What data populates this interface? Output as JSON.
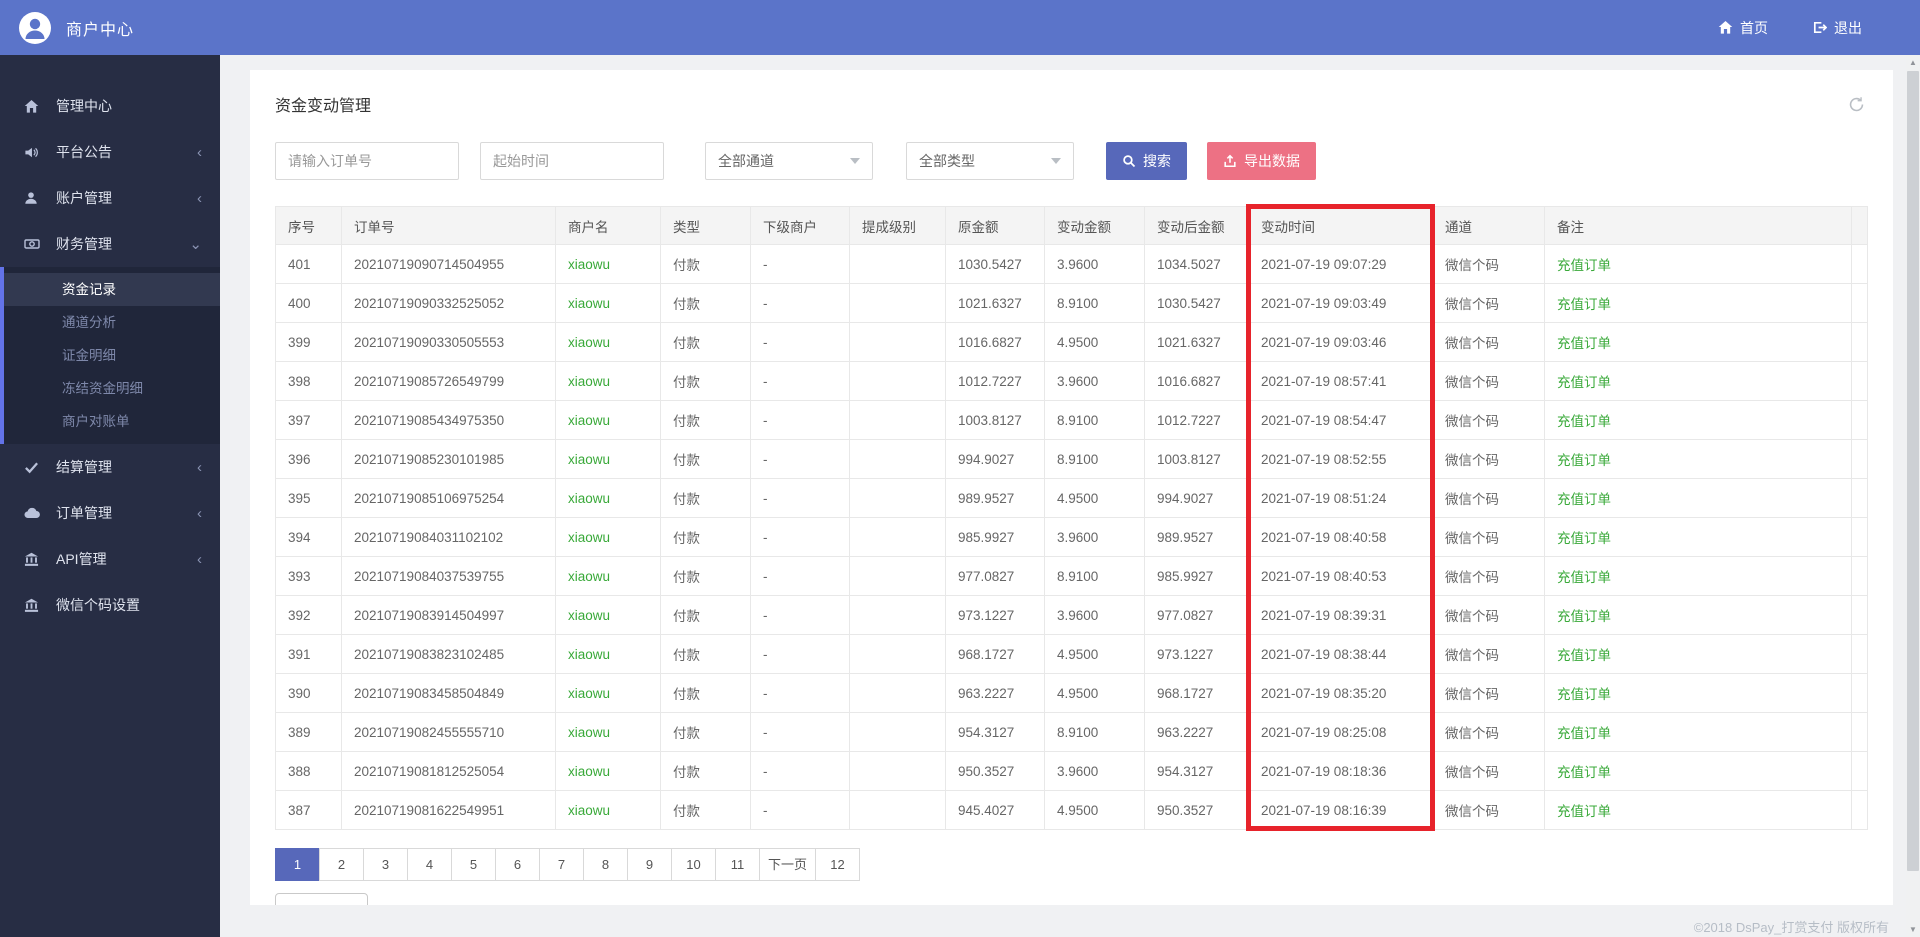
{
  "navbar": {
    "brand": "商户中心",
    "home_label": "首页",
    "logout_label": "退出"
  },
  "sidebar": {
    "items": [
      {
        "label": "管理中心",
        "chevron": ""
      },
      {
        "label": "平台公告",
        "chevron": "‹"
      },
      {
        "label": "账户管理",
        "chevron": "‹"
      },
      {
        "label": "财务管理",
        "chevron": "⌄",
        "children": [
          "资金记录",
          "通道分析",
          "证金明细",
          "冻结资金明细",
          "商户对账单"
        ],
        "active_child": "资金记录"
      },
      {
        "label": "结算管理",
        "chevron": "‹"
      },
      {
        "label": "订单管理",
        "chevron": "‹"
      },
      {
        "label": "API管理",
        "chevron": "‹"
      },
      {
        "label": "微信个码设置",
        "chevron": ""
      }
    ]
  },
  "page": {
    "title": "资金变动管理"
  },
  "filters": {
    "order_placeholder": "请输入订单号",
    "time_placeholder": "起始时间",
    "channel_selected": "全部通道",
    "type_selected": "全部类型",
    "search_label": "搜索",
    "export_label": "导出数据"
  },
  "table": {
    "columns": [
      "序号",
      "订单号",
      "商户名",
      "类型",
      "下级商户",
      "提成级别",
      "原金额",
      "变动金额",
      "变动后金额",
      "变动时间",
      "通道",
      "备注"
    ],
    "rows": [
      [
        "401",
        "20210719090714504955",
        "xiaowu",
        "付款",
        "-",
        "",
        "1030.5427",
        "3.9600",
        "1034.5027",
        "2021-07-19 09:07:29",
        "微信个码",
        "充值订单"
      ],
      [
        "400",
        "20210719090332525052",
        "xiaowu",
        "付款",
        "-",
        "",
        "1021.6327",
        "8.9100",
        "1030.5427",
        "2021-07-19 09:03:49",
        "微信个码",
        "充值订单"
      ],
      [
        "399",
        "20210719090330505553",
        "xiaowu",
        "付款",
        "-",
        "",
        "1016.6827",
        "4.9500",
        "1021.6327",
        "2021-07-19 09:03:46",
        "微信个码",
        "充值订单"
      ],
      [
        "398",
        "20210719085726549799",
        "xiaowu",
        "付款",
        "-",
        "",
        "1012.7227",
        "3.9600",
        "1016.6827",
        "2021-07-19 08:57:41",
        "微信个码",
        "充值订单"
      ],
      [
        "397",
        "20210719085434975350",
        "xiaowu",
        "付款",
        "-",
        "",
        "1003.8127",
        "8.9100",
        "1012.7227",
        "2021-07-19 08:54:47",
        "微信个码",
        "充值订单"
      ],
      [
        "396",
        "20210719085230101985",
        "xiaowu",
        "付款",
        "-",
        "",
        "994.9027",
        "8.9100",
        "1003.8127",
        "2021-07-19 08:52:55",
        "微信个码",
        "充值订单"
      ],
      [
        "395",
        "20210719085106975254",
        "xiaowu",
        "付款",
        "-",
        "",
        "989.9527",
        "4.9500",
        "994.9027",
        "2021-07-19 08:51:24",
        "微信个码",
        "充值订单"
      ],
      [
        "394",
        "20210719084031102102",
        "xiaowu",
        "付款",
        "-",
        "",
        "985.9927",
        "3.9600",
        "989.9527",
        "2021-07-19 08:40:58",
        "微信个码",
        "充值订单"
      ],
      [
        "393",
        "20210719084037539755",
        "xiaowu",
        "付款",
        "-",
        "",
        "977.0827",
        "8.9100",
        "985.9927",
        "2021-07-19 08:40:53",
        "微信个码",
        "充值订单"
      ],
      [
        "392",
        "20210719083914504997",
        "xiaowu",
        "付款",
        "-",
        "",
        "973.1227",
        "3.9600",
        "977.0827",
        "2021-07-19 08:39:31",
        "微信个码",
        "充值订单"
      ],
      [
        "391",
        "20210719083823102485",
        "xiaowu",
        "付款",
        "-",
        "",
        "968.1727",
        "4.9500",
        "973.1227",
        "2021-07-19 08:38:44",
        "微信个码",
        "充值订单"
      ],
      [
        "390",
        "20210719083458504849",
        "xiaowu",
        "付款",
        "-",
        "",
        "963.2227",
        "4.9500",
        "968.1727",
        "2021-07-19 08:35:20",
        "微信个码",
        "充值订单"
      ],
      [
        "389",
        "20210719082455555710",
        "xiaowu",
        "付款",
        "-",
        "",
        "954.3127",
        "8.9100",
        "963.2227",
        "2021-07-19 08:25:08",
        "微信个码",
        "充值订单"
      ],
      [
        "388",
        "20210719081812525054",
        "xiaowu",
        "付款",
        "-",
        "",
        "950.3527",
        "3.9600",
        "954.3127",
        "2021-07-19 08:18:36",
        "微信个码",
        "充值订单"
      ],
      [
        "387",
        "20210719081622549951",
        "xiaowu",
        "付款",
        "-",
        "",
        "945.4027",
        "4.9500",
        "950.3527",
        "2021-07-19 08:16:39",
        "微信个码",
        "充值订单"
      ]
    ],
    "green_column_indexes": [
      2,
      11
    ]
  },
  "pagination": {
    "items": [
      "1",
      "2",
      "3",
      "4",
      "5",
      "6",
      "7",
      "8",
      "9",
      "10",
      "11",
      "下一页",
      "12"
    ],
    "active_index": 0
  },
  "footer": {
    "copyright": "©2018 DsPay_打赏支付 版权所有"
  },
  "colors": {
    "navbar_blue": "#5b74c9",
    "button_blue": "#5768ba",
    "export_pink": "#ed7184",
    "highlight_red": "#e7232b",
    "green_text": "#39a939"
  }
}
